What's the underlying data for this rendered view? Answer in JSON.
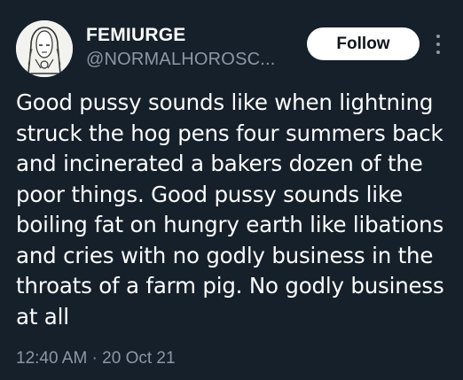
{
  "author": {
    "display_name": "FEMIURGE",
    "handle": "@NORMALHOROSC..."
  },
  "follow_button": {
    "label": "Follow"
  },
  "more_button": {
    "icon": "more-vertical-icon"
  },
  "tweet": {
    "text": "Good pussy sounds like when lightning\nstruck the hog pens four summers back\nand incinerated a bakers dozen of the\npoor things. Good pussy sounds like\nboiling fat on hungry earth like libations\nand cries with no godly business in the\nthroats of a farm pig. No godly business\nat all",
    "timestamp": "12:40 AM · 20 Oct 21"
  },
  "colors": {
    "background": "#15202b",
    "primary_text": "#ffffff",
    "secondary_text": "#8b98a5",
    "button_bg": "#ffffff",
    "button_text": "#0f1419"
  }
}
